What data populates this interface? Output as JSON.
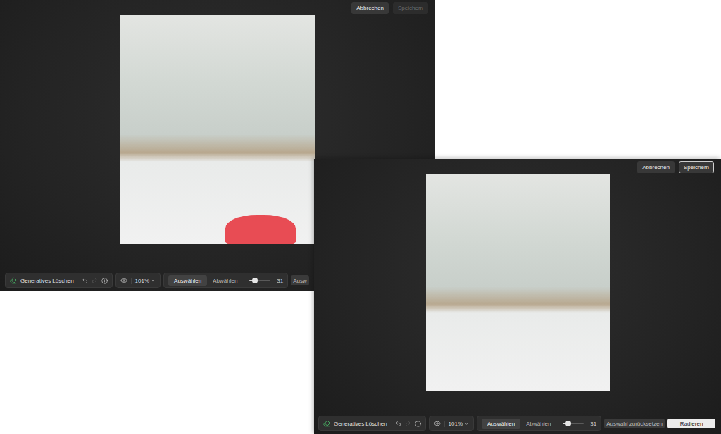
{
  "windows": [
    {
      "top_buttons": [
        {
          "label": "Abbrechen",
          "disabled": false,
          "highlighted": false
        },
        {
          "label": "Speichern",
          "disabled": true,
          "highlighted": false
        }
      ],
      "mask_visible": true,
      "toolbar": {
        "tool": "Generatives Löschen",
        "undo_disabled": false,
        "redo_disabled": true,
        "zoom": "101%",
        "modes": [
          {
            "label": "Auswählen",
            "selected": true
          },
          {
            "label": "Abwählen",
            "selected": false
          }
        ],
        "brush": {
          "level": 0.25,
          "reading": "31"
        },
        "actions": [
          {
            "label": "Ausw",
            "primary": false
          }
        ]
      }
    },
    {
      "top_buttons": [
        {
          "label": "Abbrechen",
          "disabled": false,
          "highlighted": false
        },
        {
          "label": "Speichern",
          "disabled": false,
          "highlighted": true
        }
      ],
      "mask_visible": false,
      "toolbar": {
        "tool": "Generatives Löschen",
        "undo_disabled": false,
        "redo_disabled": true,
        "zoom": "101%",
        "modes": [
          {
            "label": "Auswählen",
            "selected": true
          },
          {
            "label": "Abwählen",
            "selected": false
          }
        ],
        "brush": {
          "level": 0.25,
          "reading": "31"
        },
        "actions": [
          {
            "label": "Auswahl zurücksetzen",
            "primary": false
          },
          {
            "label": "Radieren",
            "primary": true
          }
        ]
      }
    }
  ]
}
